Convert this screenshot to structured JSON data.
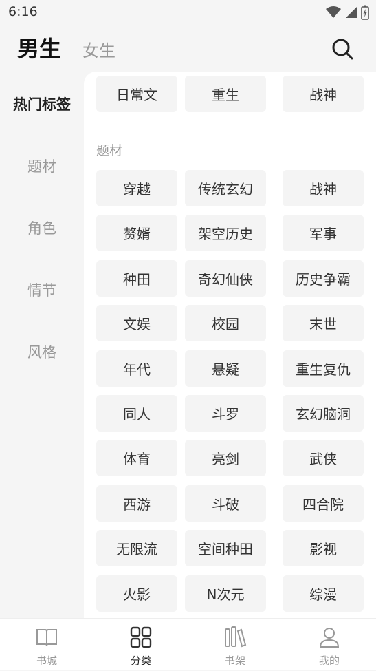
{
  "status": {
    "time": "6:16"
  },
  "header": {
    "tabs": [
      "男生",
      "女生"
    ]
  },
  "sidebar": {
    "items": [
      "热门标签",
      "题材",
      "角色",
      "情节",
      "风格"
    ]
  },
  "hot_tags": [
    "日常文",
    "重生",
    "战神"
  ],
  "theme_section": {
    "title": "题材",
    "tags": [
      "穿越",
      "传统玄幻",
      "战神",
      "赘婿",
      "架空历史",
      "军事",
      "种田",
      "奇幻仙侠",
      "历史争霸",
      "文娱",
      "校园",
      "末世",
      "年代",
      "悬疑",
      "重生复仇",
      "同人",
      "斗罗",
      "玄幻脑洞",
      "体育",
      "亮剑",
      "武侠",
      "西游",
      "斗破",
      "四合院",
      "无限流",
      "空间种田",
      "影视",
      "火影",
      "N次元",
      "综漫"
    ]
  },
  "bottom_nav": {
    "items": [
      "书城",
      "分类",
      "书架",
      "我的"
    ],
    "active": "分类"
  },
  "colors": {
    "active_text": "#222222",
    "inactive_text": "#999999",
    "tag_bg": "#f4f4f4"
  }
}
